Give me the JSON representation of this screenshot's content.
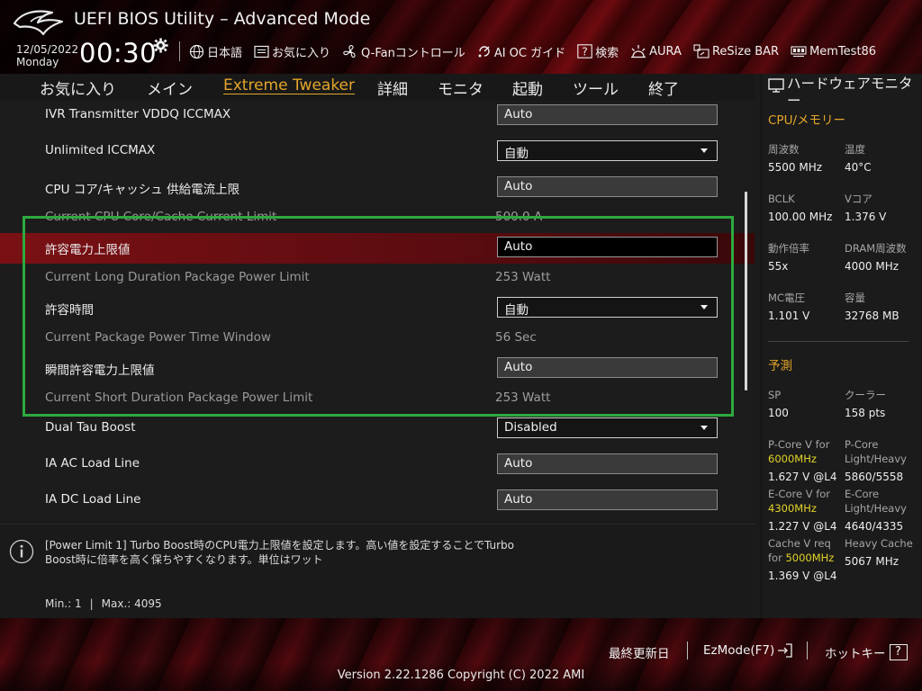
{
  "header": {
    "title": "UEFI BIOS Utility – Advanced Mode",
    "date": "12/05/2022",
    "day": "Monday",
    "time": "00:30",
    "toolbar": [
      {
        "label": "日本語",
        "icon": "globe-icon"
      },
      {
        "label": "お気に入り",
        "icon": "favorites-icon"
      },
      {
        "label": "Q-Fanコントロール",
        "icon": "fan-icon"
      },
      {
        "label": "AI OC ガイド",
        "icon": "ai-oc-icon"
      },
      {
        "label": "検索",
        "icon": "search-icon"
      },
      {
        "label": "AURA",
        "icon": "aura-icon"
      },
      {
        "label": "ReSize BAR",
        "icon": "resize-bar-icon"
      },
      {
        "label": "MemTest86",
        "icon": "memtest-icon"
      }
    ]
  },
  "nav": {
    "tabs": [
      "お気に入り",
      "メイン",
      "Extreme Tweaker",
      "詳細",
      "モニタ",
      "起動",
      "ツール",
      "終了"
    ],
    "active": "Extreme Tweaker"
  },
  "settings": {
    "rows": [
      {
        "label": "IVR Transmitter VDDQ ICCMAX",
        "value": "Auto",
        "type": "field"
      },
      {
        "label": "Unlimited ICCMAX",
        "value": "自動",
        "type": "dropdown"
      },
      {
        "label": "CPU コア/キャッシュ 供給電流上限",
        "value": "Auto",
        "type": "field"
      },
      {
        "label": "Current CPU Core/Cache Current Limit",
        "value": "500.0 A",
        "type": "readonly"
      },
      {
        "label": "許容電力上限値",
        "value": "Auto",
        "type": "field-active"
      },
      {
        "label": "Current Long Duration Package Power Limit",
        "value": "253 Watt",
        "type": "readonly"
      },
      {
        "label": "許容時間",
        "value": "自動",
        "type": "dropdown"
      },
      {
        "label": "Current Package Power Time Window",
        "value": "56 Sec",
        "type": "readonly"
      },
      {
        "label": "瞬間許容電力上限値",
        "value": "Auto",
        "type": "field"
      },
      {
        "label": "Current Short Duration Package Power Limit",
        "value": "253 Watt",
        "type": "readonly"
      },
      {
        "label": "Dual Tau Boost",
        "value": "Disabled",
        "type": "dropdown"
      },
      {
        "label": "IA AC Load Line",
        "value": "Auto",
        "type": "field"
      },
      {
        "label": "IA DC Load Line",
        "value": "Auto",
        "type": "field"
      }
    ]
  },
  "help": {
    "line1": "[Power Limit 1] Turbo Boost時のCPU電力上限値を設定します。高い値を設定することでTurbo",
    "line2": "Boost時に倍率を高く保ちやすくなります。単位はワット",
    "min": "Min.: 1",
    "sep": "|",
    "max": "Max.: 4095"
  },
  "monitor": {
    "title": "ハードウェアモニター",
    "cpu_section": "CPU/メモリー",
    "freq_label": "周波数",
    "freq_value": "5500 MHz",
    "temp_label": "温度",
    "temp_value": "40°C",
    "bclk_label": "BCLK",
    "bclk_value": "100.00 MHz",
    "vcore_label": "Vコア",
    "vcore_value": "1.376 V",
    "ratio_label": "動作倍率",
    "ratio_value": "55x",
    "dram_label": "DRAM周波数",
    "dram_value": "4000 MHz",
    "mcv_label": "MC電圧",
    "mcv_value": "1.101 V",
    "cap_label": "容量",
    "cap_value": "32768 MB",
    "predict_section": "予測",
    "sp_label": "SP",
    "sp_value": "100",
    "cooler_label": "クーラー",
    "cooler_value": "158 pts",
    "pcore_v_label": "P-Core V for",
    "pcore_v_freq": "6000MHz",
    "pcore_v_value": "1.627 V @L4",
    "pcore_lh_label1": "P-Core",
    "pcore_lh_label2": "Light/Heavy",
    "pcore_lh_value": "5860/5558",
    "ecore_v_label": "E-Core V for",
    "ecore_v_freq": "4300MHz",
    "ecore_v_value": "1.227 V @L4",
    "ecore_lh_label1": "E-Core",
    "ecore_lh_label2": "Light/Heavy",
    "ecore_lh_value": "4640/4335",
    "cache_v_label": "Cache V req",
    "cache_v_for": "for",
    "cache_v_freq": "5000MHz",
    "cache_v_value": "1.369 V @L4",
    "heavy_cache_label": "Heavy Cache",
    "heavy_cache_value": "5067 MHz"
  },
  "footer": {
    "last_modified": "最終更新日",
    "ezmode": "EzMode(F7)",
    "hotkey": "ホットキー",
    "hotkey_glyph": "?",
    "version": "Version 2.22.1286 Copyright (C) 2022 AMI"
  },
  "colors": {
    "accent": "#e3a62a",
    "selected_row": "#7a1014",
    "highlight_box": "#2daa3e",
    "freq_accent": "#e3d32a"
  }
}
